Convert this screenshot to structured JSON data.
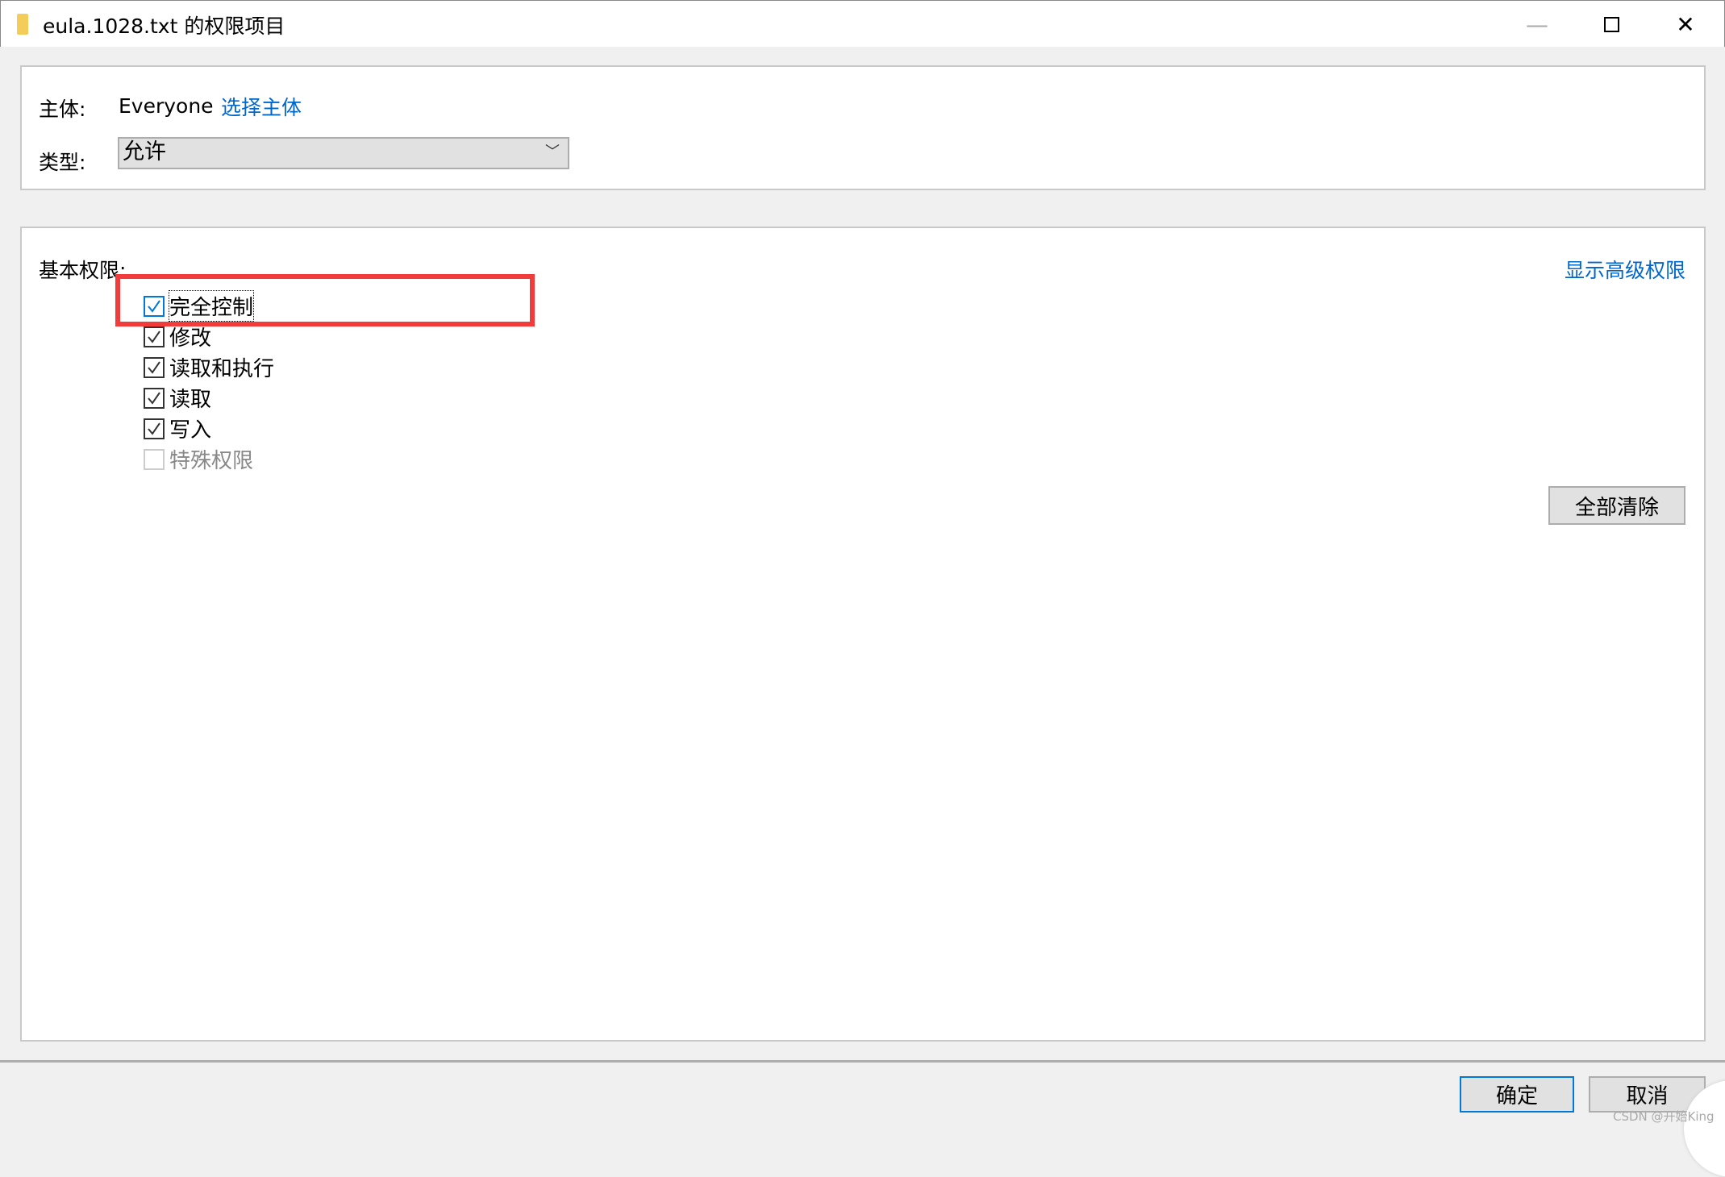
{
  "window": {
    "title": "eula.1028.txt 的权限项目",
    "icon": "folder-icon",
    "minimize_icon": "minimize-icon",
    "maximize_icon": "maximize-icon",
    "close_icon": "close-icon"
  },
  "principal": {
    "label": "主体:",
    "value": "Everyone",
    "select_link": "选择主体"
  },
  "type": {
    "label": "类型:",
    "value": "允许"
  },
  "permissions": {
    "label": "基本权限:",
    "advanced_link": "显示高级权限",
    "items": [
      {
        "label": "完全控制",
        "checked": true,
        "focused": true
      },
      {
        "label": "修改",
        "checked": true
      },
      {
        "label": "读取和执行",
        "checked": true
      },
      {
        "label": "读取",
        "checked": true
      },
      {
        "label": "写入",
        "checked": true
      },
      {
        "label": "特殊权限",
        "checked": false,
        "disabled": true
      }
    ],
    "clear_all": "全部清除"
  },
  "footer": {
    "ok": "确定",
    "cancel": "取消"
  },
  "watermark": "CSDN @开始King",
  "colors": {
    "accent": "#0078d7",
    "link": "#0066cc",
    "highlight": "#f23b3b"
  }
}
